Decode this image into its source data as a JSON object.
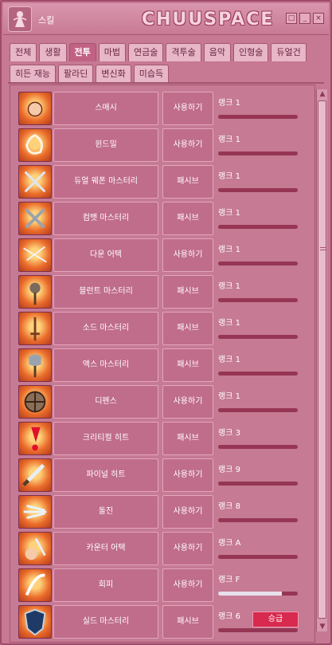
{
  "window": {
    "title": "스킬",
    "brand": "CHUUSPACE"
  },
  "controls": {
    "restore_label": "□",
    "minimize_label": "_",
    "close_label": "×"
  },
  "tabs_row1": [
    "전체",
    "생활",
    "전투",
    "마법",
    "연금술",
    "격투술",
    "음악",
    "인형술",
    "듀얼건"
  ],
  "tabs_row2": [
    "히든 재능",
    "팔라딘",
    "변신화",
    "미습득"
  ],
  "active_tab": "전투",
  "skills": [
    {
      "name": "스매시",
      "type": "사용하기",
      "rank": "랭크 1",
      "progress": 0.0,
      "icon": "fist-icon"
    },
    {
      "name": "윈드밀",
      "type": "사용하기",
      "rank": "랭크 1",
      "progress": 0.0,
      "icon": "windmill-icon"
    },
    {
      "name": "듀얼 웨폰 마스터리",
      "type": "패시브",
      "rank": "랭크 1",
      "progress": 0.0,
      "icon": "crossed-swords-icon"
    },
    {
      "name": "컴뱃 마스터리",
      "type": "패시브",
      "rank": "랭크 1",
      "progress": 0.0,
      "icon": "crossed-weapons-icon"
    },
    {
      "name": "다운 어택",
      "type": "사용하기",
      "rank": "랭크 1",
      "progress": 0.0,
      "icon": "down-attack-icon"
    },
    {
      "name": "블런트 마스터리",
      "type": "패시브",
      "rank": "랭크 1",
      "progress": 0.0,
      "icon": "mace-icon"
    },
    {
      "name": "소드 마스터리",
      "type": "패시브",
      "rank": "랭크 1",
      "progress": 0.0,
      "icon": "sword-icon"
    },
    {
      "name": "액스 마스터리",
      "type": "패시브",
      "rank": "랭크 1",
      "progress": 0.0,
      "icon": "axe-icon"
    },
    {
      "name": "디펜스",
      "type": "사용하기",
      "rank": "랭크 1",
      "progress": 0.0,
      "icon": "shield-icon"
    },
    {
      "name": "크리티컬 히트",
      "type": "패시브",
      "rank": "랭크 3",
      "progress": 0.0,
      "icon": "exclamation-icon"
    },
    {
      "name": "파이널 히트",
      "type": "사용하기",
      "rank": "랭크 9",
      "progress": 0.0,
      "icon": "final-hit-icon"
    },
    {
      "name": "돌진",
      "type": "사용하기",
      "rank": "랭크 8",
      "progress": 0.0,
      "icon": "charge-icon"
    },
    {
      "name": "카운터 어택",
      "type": "사용하기",
      "rank": "랭크 A",
      "progress": 0.0,
      "icon": "counter-icon"
    },
    {
      "name": "회피",
      "type": "사용하기",
      "rank": "랭크 F",
      "progress": 0.8,
      "icon": "dodge-icon"
    },
    {
      "name": "실드 마스터리",
      "type": "패시브",
      "rank": "랭크 6",
      "progress": 0.0,
      "icon": "shield-mastery-icon",
      "upgrade": "승급"
    }
  ],
  "colors": {
    "accent": "#d8294f",
    "panel": "#c77893",
    "bar_fill": "#e6e0ec"
  }
}
